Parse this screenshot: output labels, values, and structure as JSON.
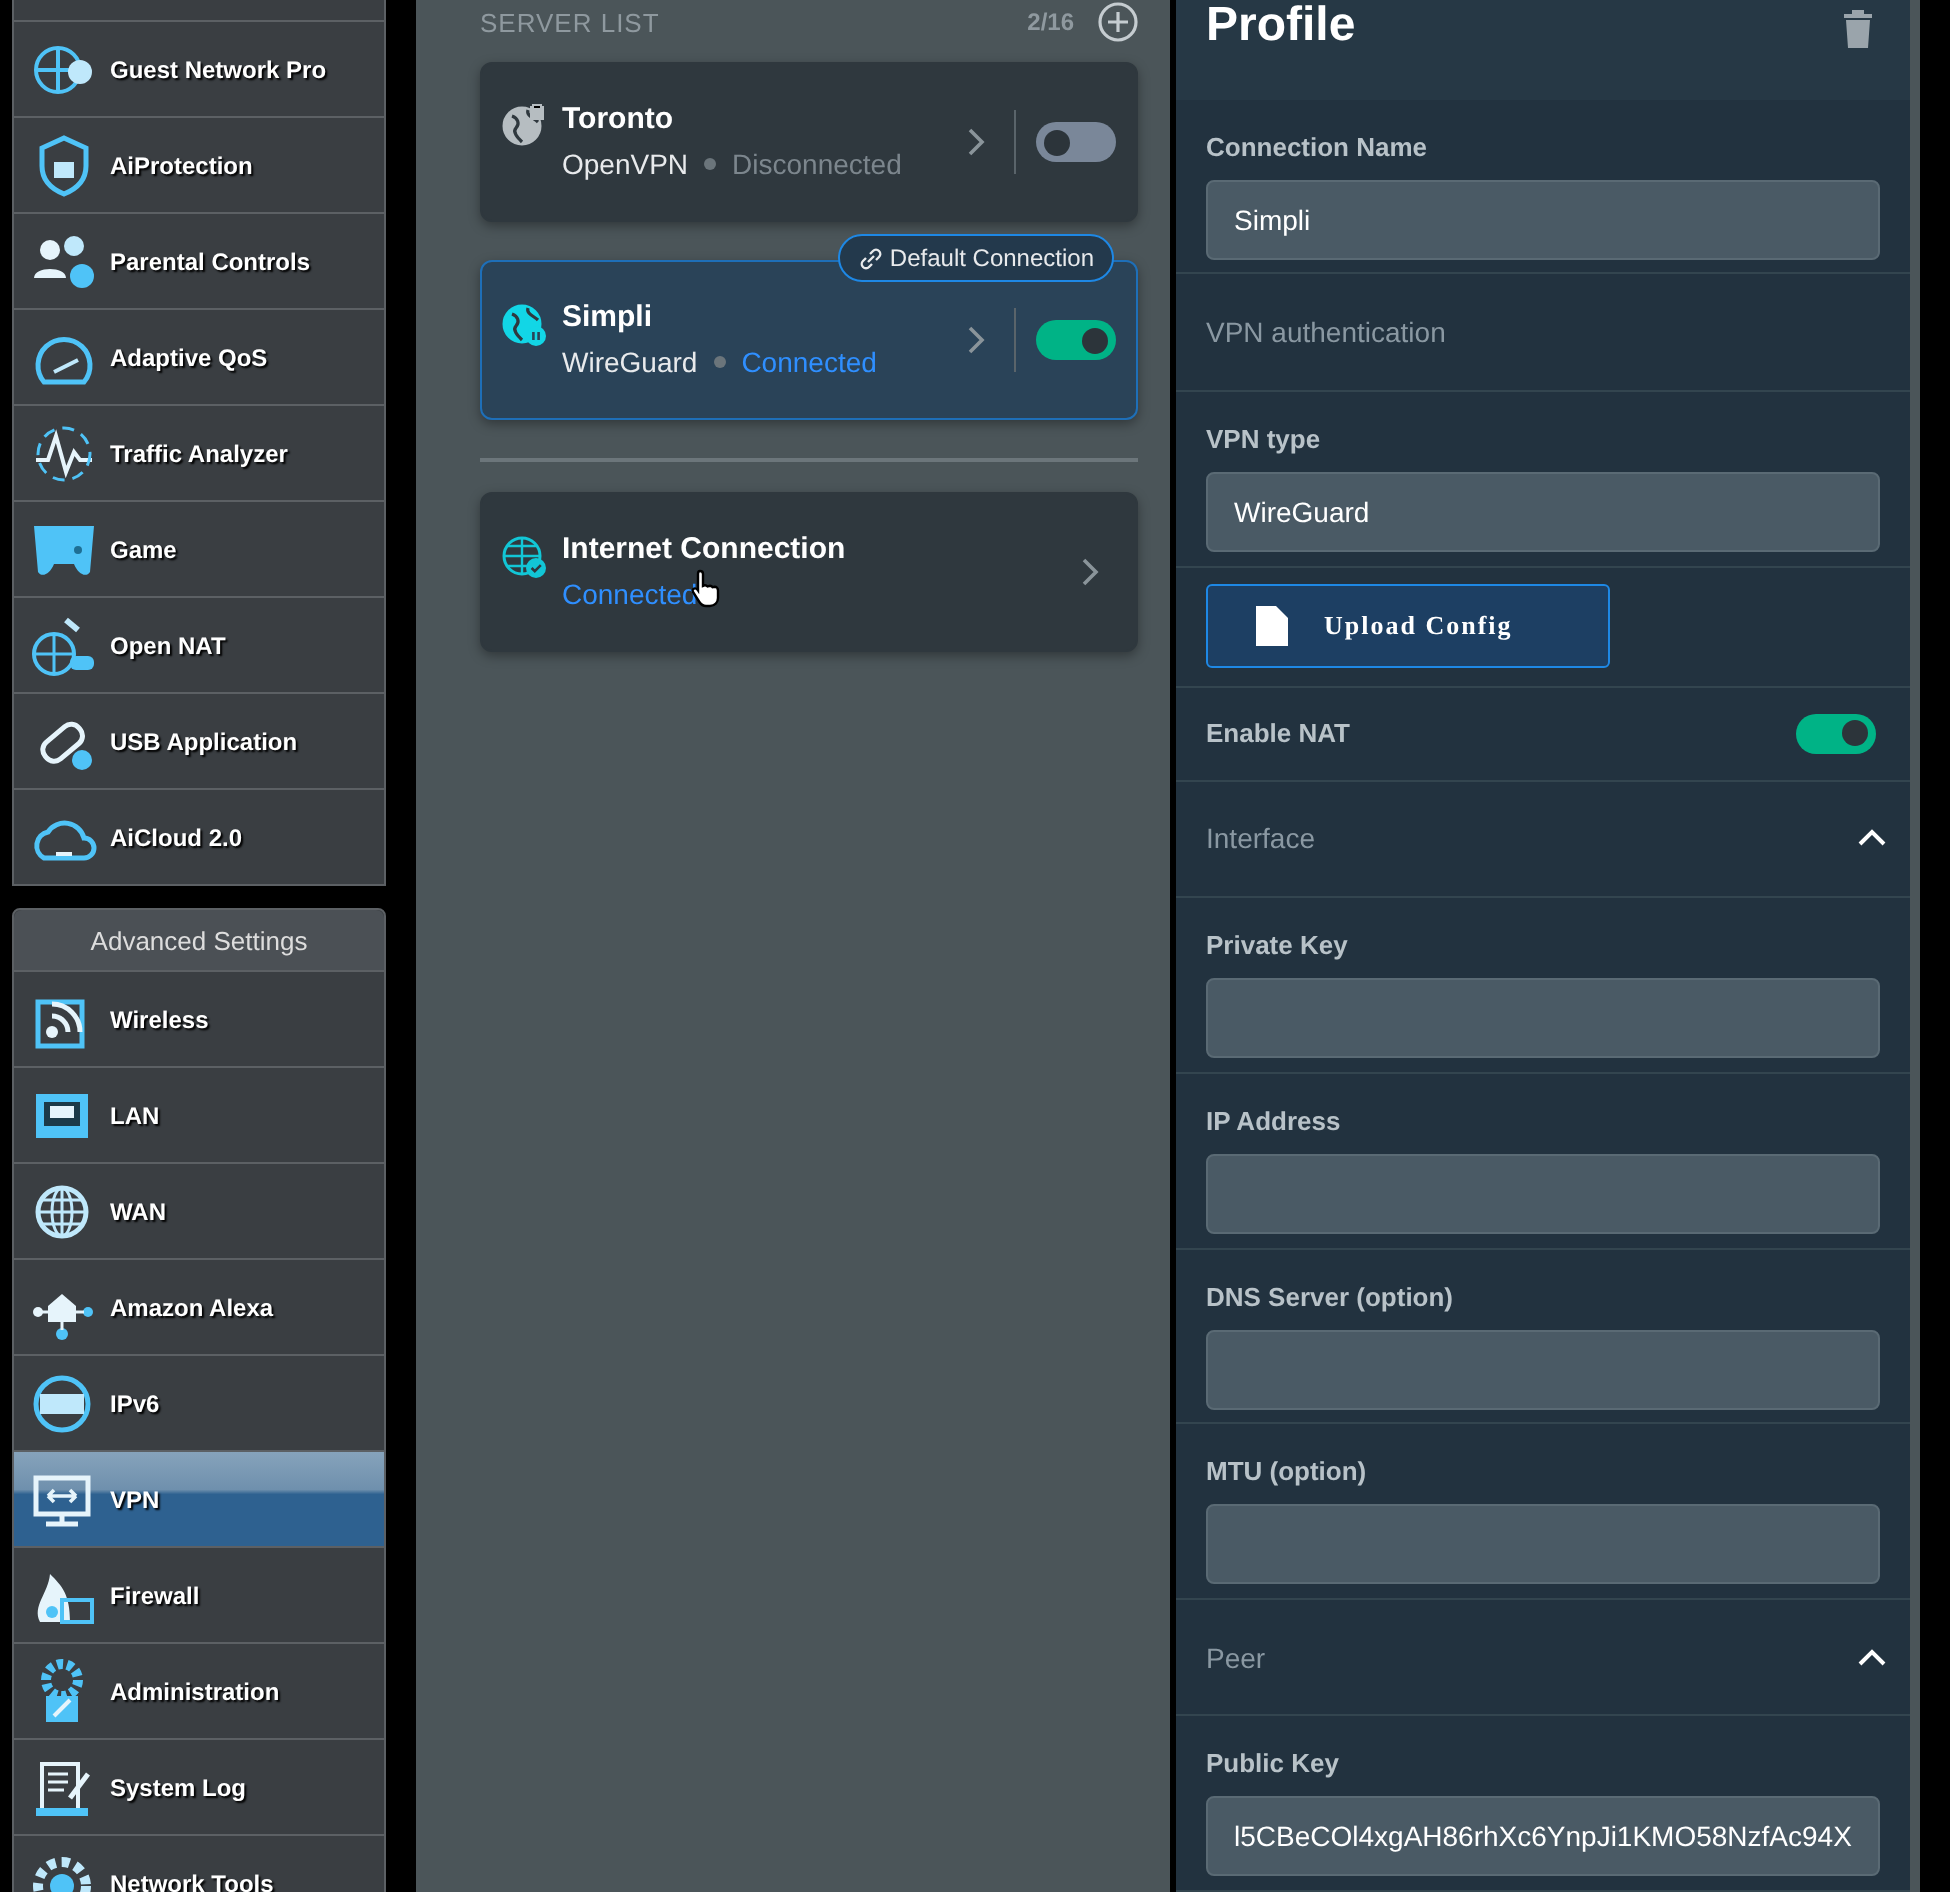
{
  "sidebar": {
    "general_items": [
      {
        "label": "Guest Network Pro",
        "selected": false
      },
      {
        "label": "AiProtection",
        "selected": false
      },
      {
        "label": "Parental Controls",
        "selected": false
      },
      {
        "label": "Adaptive QoS",
        "selected": false
      },
      {
        "label": "Traffic Analyzer",
        "selected": false
      },
      {
        "label": "Game",
        "selected": false
      },
      {
        "label": "Open NAT",
        "selected": false
      },
      {
        "label": "USB Application",
        "selected": false
      },
      {
        "label": "AiCloud 2.0",
        "selected": false
      }
    ],
    "advanced_header": "Advanced Settings",
    "advanced_items": [
      {
        "label": "Wireless",
        "selected": false
      },
      {
        "label": "LAN",
        "selected": false
      },
      {
        "label": "WAN",
        "selected": false
      },
      {
        "label": "Amazon Alexa",
        "selected": false
      },
      {
        "label": "IPv6",
        "selected": false
      },
      {
        "label": "VPN",
        "selected": true
      },
      {
        "label": "Firewall",
        "selected": false
      },
      {
        "label": "Administration",
        "selected": false
      },
      {
        "label": "System Log",
        "selected": false
      },
      {
        "label": "Network Tools",
        "selected": false
      }
    ]
  },
  "server_list": {
    "title": "SERVER LIST",
    "count": "2/16",
    "servers": [
      {
        "name": "Toronto",
        "protocol": "OpenVPN",
        "status": "Disconnected",
        "connected": false,
        "on": false,
        "selected": false
      },
      {
        "name": "Simpli",
        "protocol": "WireGuard",
        "status": "Connected",
        "connected": true,
        "on": true,
        "selected": true,
        "badge": "Default Connection"
      }
    ],
    "internet": {
      "name": "Internet Connection",
      "status": "Connected"
    }
  },
  "profile": {
    "title": "Profile",
    "rows": [
      {
        "kind": "field",
        "label": "Connection Name",
        "value": "Simpli"
      },
      {
        "kind": "section",
        "label": "VPN authentication"
      },
      {
        "kind": "field",
        "label": "VPN type",
        "value": "WireGuard"
      },
      {
        "kind": "upload",
        "label": "Upload Config"
      },
      {
        "kind": "toggle",
        "label": "Enable NAT",
        "on": true
      },
      {
        "kind": "section",
        "label": "Interface",
        "expanded": true
      },
      {
        "kind": "field",
        "label": "Private Key"
      },
      {
        "kind": "field",
        "label": "IP Address"
      },
      {
        "kind": "field",
        "label": "DNS Server (option)"
      },
      {
        "kind": "field",
        "label": "MTU (option)"
      },
      {
        "kind": "section",
        "label": "Peer",
        "expanded": true
      },
      {
        "kind": "field",
        "label": "Public Key",
        "value": "l5CBeCOl4xgAH86rhXc6YnpJi1KMO58NzfAc94X"
      }
    ]
  }
}
